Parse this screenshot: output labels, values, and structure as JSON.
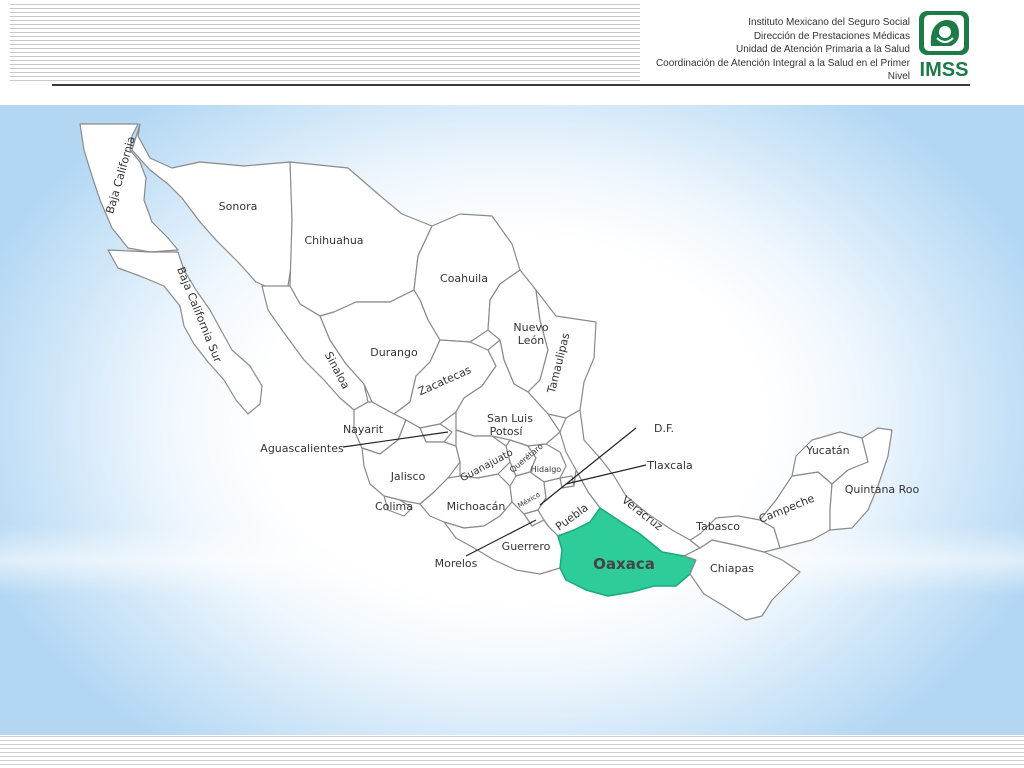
{
  "header": {
    "lines": [
      "Instituto Mexicano del Seguro Social",
      "Dirección de Prestaciones Médicas",
      "Unidad de Atención Primaria a la Salud",
      "Coordinación de Atención Integral a la Salud en el Primer",
      "Nivel"
    ],
    "logo_text": "IMSS"
  },
  "map": {
    "highlight_color": "#2dcc9a",
    "highlighted_state": "Oaxaca",
    "states": {
      "baja_california": "Baja California",
      "baja_california_sur": "Baja California Sur",
      "sonora": "Sonora",
      "chihuahua": "Chihuahua",
      "coahuila": "Coahuila",
      "nuevo_leon_1": "Nuevo",
      "nuevo_leon_2": "León",
      "tamaulipas": "Tamaulipas",
      "sinaloa": "Sinaloa",
      "durango": "Durango",
      "zacatecas": "Zacatecas",
      "san_luis_potosi_1": "San Luis",
      "san_luis_potosi_2": "Potosí",
      "nayarit": "Nayarit",
      "aguascalientes": "Aguascalientes",
      "guanajuato": "Guanajuato",
      "queretaro": "Querétaro",
      "hidalgo": "Hidalgo",
      "jalisco": "Jalisco",
      "colima": "Colima",
      "michoacan": "Michoacán",
      "mexico": "México",
      "df": "D.F.",
      "tlaxcala": "Tlaxcala",
      "puebla": "Puebla",
      "veracruz": "Veracruz",
      "morelos": "Morelos",
      "guerrero": "Guerrero",
      "oaxaca": "Oaxaca",
      "chiapas": "Chiapas",
      "tabasco": "Tabasco",
      "campeche": "Campeche",
      "yucatan": "Yucatán",
      "quintana_roo": "Quintana Roo"
    }
  }
}
